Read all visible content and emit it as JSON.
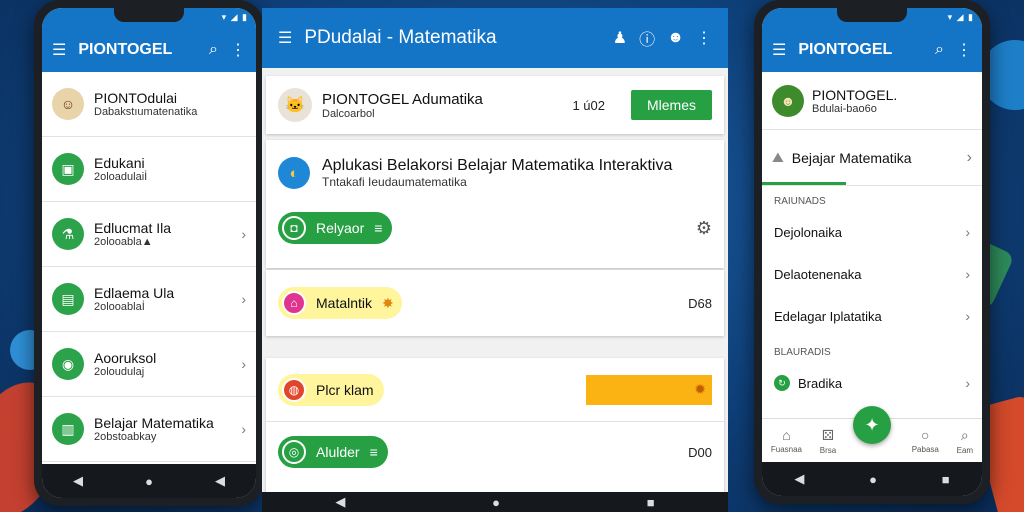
{
  "left_phone": {
    "status_icons": "▾ ◢ ▮",
    "app_title": "PIONTOGEL",
    "items": [
      {
        "title": "PIONTOdulai",
        "subtitle": "Dabakstıumatenatika",
        "icon": "face-avatar"
      },
      {
        "title": "Edukani",
        "subtitle": "2oloadulaiİ",
        "icon": "cube-icon"
      },
      {
        "title": "Edlucmat Ila",
        "subtitle": "2olooabla▲",
        "icon": "lab-icon"
      },
      {
        "title": "Edlaema Ula",
        "subtitle": "2olooablaİ",
        "icon": "board-icon"
      },
      {
        "title": "Aooruksol",
        "subtitle": "2oloudulaj",
        "icon": "robot-icon"
      },
      {
        "title": "Belajar Matematika",
        "subtitle": "2obstoabkay",
        "icon": "book-icon"
      }
    ]
  },
  "middle": {
    "app_title": "PDudalai - Matematika",
    "header": {
      "title": "PIONTOGEL Adumatika",
      "subtitle": "Dalcoarbol",
      "count": "1 ú02",
      "button": "Mlemes"
    },
    "feature": {
      "title": "Aplukasi Belakorsi Belajar Matematika Interaktiva",
      "subtitle": "Tntakafi Ieudaumatematika"
    },
    "rows": [
      {
        "pill": "Relyaor",
        "pill_color": "#27a043",
        "right": "gear",
        "num": ""
      },
      {
        "pill": "Matalntik",
        "pill_color": "#e0358f",
        "right": "num",
        "num": "D68"
      },
      {
        "pill": "Plcr klam",
        "pill_color": "#e0462b",
        "right": "orange",
        "num": ""
      },
      {
        "pill": "Alulder",
        "pill_color": "#27a043",
        "right": "num",
        "num": "D00"
      }
    ]
  },
  "right_phone": {
    "status_icons": "▾ ◢ ▮",
    "app_title": "PIONTOGEL",
    "header": {
      "title": "PIONTOGEL.",
      "subtitle": "Bdulai-bao6o"
    },
    "tab": "Bejajar Matematika",
    "section1": "RAIUNADS",
    "items1": [
      "Dejolonaika",
      "Delaotenenaka",
      "Edelagar Iplatatika"
    ],
    "section2": "BLAURADIS",
    "items2": [
      "Bradika"
    ],
    "bottom_nav": [
      {
        "label": "Fuasnaa",
        "icon": "home-icon"
      },
      {
        "label": "Brsa",
        "icon": "dice-icon"
      },
      {
        "label": "Pabasa",
        "icon": "circle-icon"
      },
      {
        "label": "Eam",
        "icon": "search-icon"
      }
    ]
  },
  "colors": {
    "primary": "#1475c7",
    "accent": "#27a043",
    "orange": "#fbb313"
  }
}
